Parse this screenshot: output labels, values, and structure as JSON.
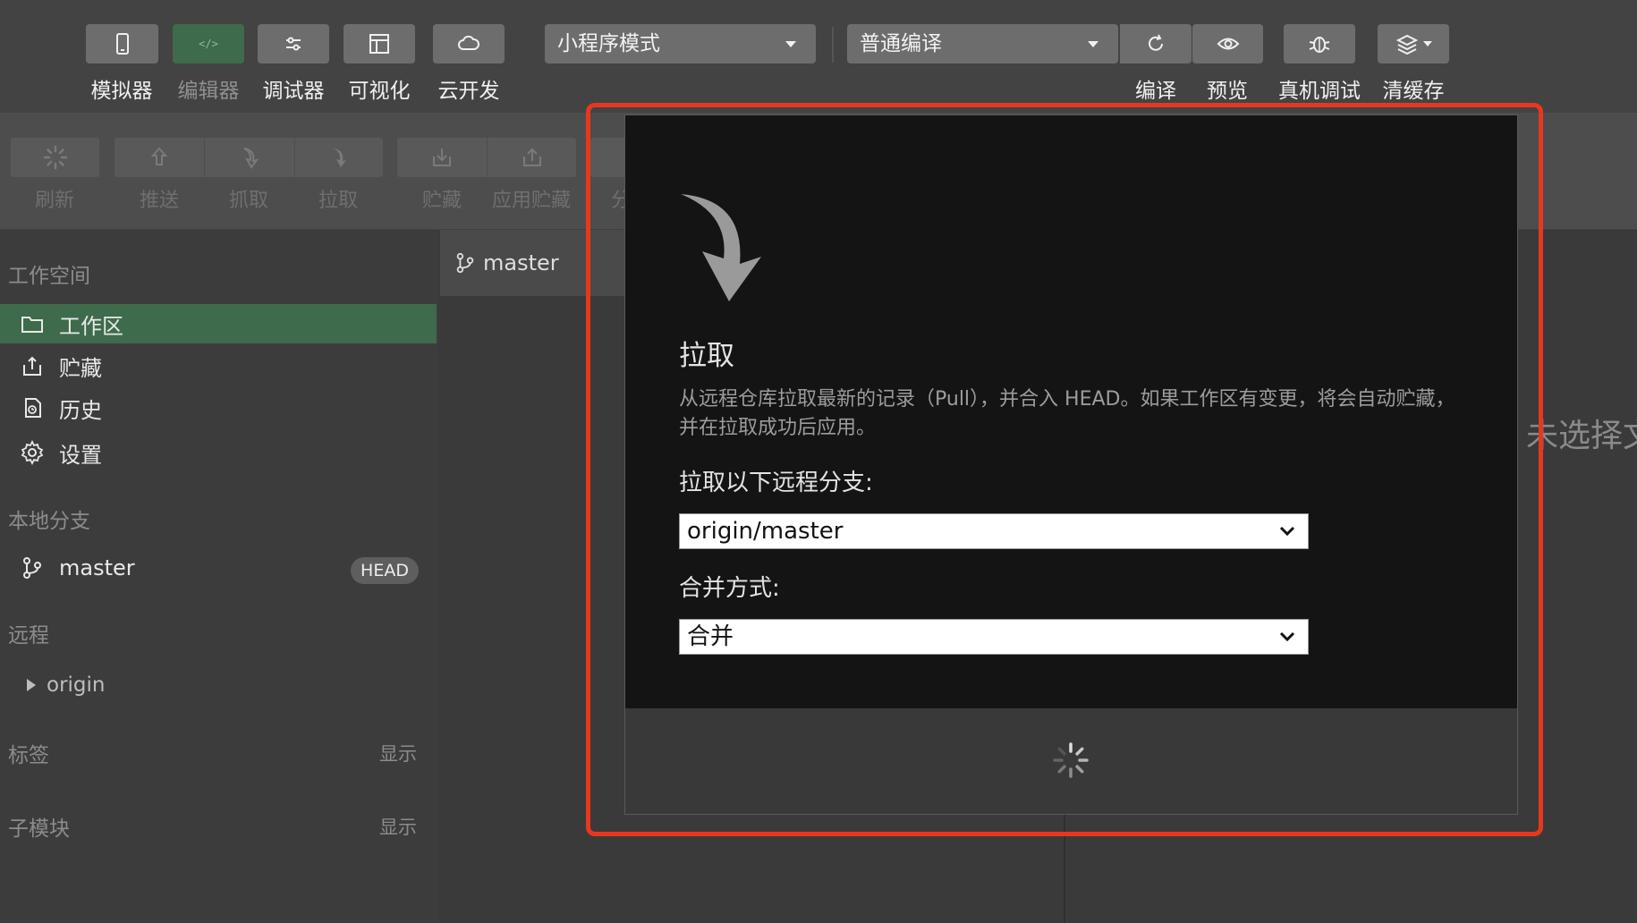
{
  "toolbar": {
    "buttons": [
      {
        "label": "模拟器",
        "icon": "phone-icon"
      },
      {
        "label": "编辑器",
        "icon": "code-icon"
      },
      {
        "label": "调试器",
        "icon": "sliders-icon"
      },
      {
        "label": "可视化",
        "icon": "layout-icon"
      },
      {
        "label": "云开发",
        "icon": "cloud-icon"
      }
    ],
    "mode_select": "小程序模式",
    "compile_select": "普通编译",
    "actions": [
      {
        "label": "编译",
        "icon": "refresh-icon"
      },
      {
        "label": "预览",
        "icon": "eye-icon"
      },
      {
        "label": "真机调试",
        "icon": "bug-icon"
      },
      {
        "label": "清缓存",
        "icon": "layers-icon"
      }
    ]
  },
  "gitbar": {
    "buttons": [
      {
        "label": "刷新",
        "icon": "spinner-icon"
      },
      {
        "label": "推送",
        "icon": "push-icon"
      },
      {
        "label": "抓取",
        "icon": "fetch-icon"
      },
      {
        "label": "拉取",
        "icon": "pull-icon"
      },
      {
        "label": "贮藏",
        "icon": "stash-icon"
      },
      {
        "label": "应用贮藏",
        "icon": "apply-stash-icon"
      }
    ],
    "partial_label": "分"
  },
  "sidebar": {
    "workspace_title": "工作空间",
    "items": [
      {
        "label": "工作区",
        "icon": "folder-icon"
      },
      {
        "label": "贮藏",
        "icon": "stash-icon"
      },
      {
        "label": "历史",
        "icon": "history-icon"
      },
      {
        "label": "设置",
        "icon": "gear-icon"
      }
    ],
    "local_branches_title": "本地分支",
    "local_branch": "master",
    "head_badge": "HEAD",
    "remote_title": "远程",
    "remote_name": "origin",
    "tags_title": "标签",
    "tags_show": "显示",
    "submodules_title": "子模块",
    "submodules_show": "显示"
  },
  "main": {
    "branch_tab": "master",
    "empty_text": "未选择文"
  },
  "modal": {
    "title": "拉取",
    "description": "从远程仓库拉取最新的记录（Pull），并合入 HEAD。如果工作区有变更，将会自动贮藏，并在拉取成功后应用。",
    "branch_label": "拉取以下远程分支:",
    "branch_value": "origin/master",
    "merge_label": "合并方式:",
    "merge_value": "合并"
  },
  "colors": {
    "accent_green": "#3e6b4c",
    "highlight_red": "#e8371f"
  }
}
